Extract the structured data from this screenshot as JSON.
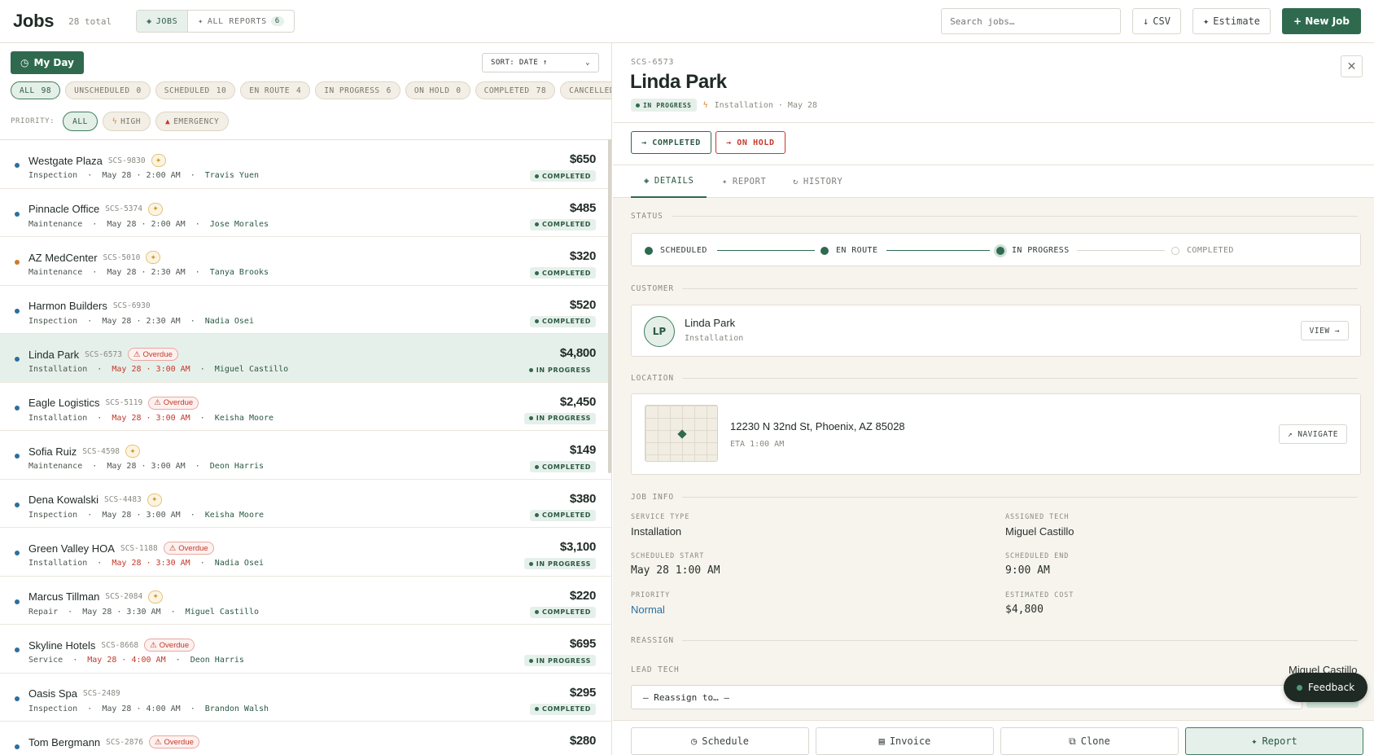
{
  "header": {
    "title": "Jobs",
    "total": "28 total",
    "seg_jobs": "JOBS",
    "seg_reports": "ALL REPORTS",
    "reports_count": "6",
    "search_placeholder": "Search jobs…",
    "csv_label": "CSV",
    "estimate_label": "Estimate",
    "new_job_label": "+ New Job"
  },
  "filters": {
    "my_day": "My Day",
    "sort_label": "SORT: DATE ↑",
    "status_chips": [
      {
        "label": "ALL",
        "count": "98"
      },
      {
        "label": "UNSCHEDULED",
        "count": "0"
      },
      {
        "label": "SCHEDULED",
        "count": "10"
      },
      {
        "label": "EN ROUTE",
        "count": "4"
      },
      {
        "label": "IN PROGRESS",
        "count": "6"
      },
      {
        "label": "ON HOLD",
        "count": "0"
      },
      {
        "label": "COMPLETED",
        "count": "78"
      },
      {
        "label": "CANCELLED",
        "count": ""
      }
    ],
    "priority_label": "PRIORITY:",
    "priority_all": "ALL",
    "priority_high": "HIGH",
    "priority_emergency": "EMERGENCY"
  },
  "jobs": [
    {
      "name": "Westgate Plaza",
      "id": "SCS-9830",
      "type": "Inspection",
      "date": "May 28 · 2:00 AM",
      "tech": "Travis Yuen",
      "amount": "$650",
      "status": "COMPLETED"
    },
    {
      "name": "Pinnacle Office",
      "id": "SCS-5374",
      "type": "Maintenance",
      "date": "May 28 · 2:00 AM",
      "tech": "Jose Morales",
      "amount": "$485",
      "status": "COMPLETED"
    },
    {
      "name": "AZ MedCenter",
      "id": "SCS-5010",
      "type": "Maintenance",
      "date": "May 28 · 2:30 AM",
      "tech": "Tanya Brooks",
      "amount": "$320",
      "status": "COMPLETED"
    },
    {
      "name": "Harmon Builders",
      "id": "SCS-6930",
      "type": "Inspection",
      "date": "May 28 · 2:30 AM",
      "tech": "Nadia Osei",
      "amount": "$520",
      "status": "COMPLETED"
    },
    {
      "name": "Linda Park",
      "id": "SCS-6573",
      "type": "Installation",
      "date": "May 28 · 3:00 AM",
      "tech": "Miguel Castillo",
      "amount": "$4,800",
      "status": "IN PROGRESS",
      "overdue": "Overdue"
    },
    {
      "name": "Eagle Logistics",
      "id": "SCS-5119",
      "type": "Installation",
      "date": "May 28 · 3:00 AM",
      "tech": "Keisha Moore",
      "amount": "$2,450",
      "status": "IN PROGRESS",
      "overdue": "Overdue"
    },
    {
      "name": "Sofia Ruiz",
      "id": "SCS-4598",
      "type": "Maintenance",
      "date": "May 28 · 3:00 AM",
      "tech": "Deon Harris",
      "amount": "$149",
      "status": "COMPLETED"
    },
    {
      "name": "Dena Kowalski",
      "id": "SCS-4483",
      "type": "Inspection",
      "date": "May 28 · 3:00 AM",
      "tech": "Keisha Moore",
      "amount": "$380",
      "status": "COMPLETED"
    },
    {
      "name": "Green Valley HOA",
      "id": "SCS-1188",
      "type": "Installation",
      "date": "May 28 · 3:30 AM",
      "tech": "Nadia Osei",
      "amount": "$3,100",
      "status": "IN PROGRESS",
      "overdue": "Overdue"
    },
    {
      "name": "Marcus Tillman",
      "id": "SCS-2084",
      "type": "Repair",
      "date": "May 28 · 3:30 AM",
      "tech": "Miguel Castillo",
      "amount": "$220",
      "status": "COMPLETED"
    },
    {
      "name": "Skyline Hotels",
      "id": "SCS-8668",
      "type": "Service",
      "date": "May 28 · 4:00 AM",
      "tech": "Deon Harris",
      "amount": "$695",
      "status": "IN PROGRESS",
      "overdue": "Overdue"
    },
    {
      "name": "Oasis Spa",
      "id": "SCS-2489",
      "type": "Inspection",
      "date": "May 28 · 4:00 AM",
      "tech": "Brandon Walsh",
      "amount": "$295",
      "status": "COMPLETED"
    },
    {
      "name": "Tom Bergmann",
      "id": "SCS-2876",
      "type": "",
      "date": "",
      "tech": "",
      "amount": "$280",
      "status": "",
      "overdue": "Overdue"
    }
  ],
  "detail": {
    "id": "SCS-6573",
    "name": "Linda Park",
    "status": "IN PROGRESS",
    "subtitle": "Installation · May 28",
    "btn_completed": "→ COMPLETED",
    "btn_on_hold": "→ ON HOLD",
    "tab_details": "DETAILS",
    "tab_report": "REPORT",
    "tab_history": "HISTORY",
    "sec_status": "STATUS",
    "steps": [
      "SCHEDULED",
      "EN ROUTE",
      "IN PROGRESS",
      "COMPLETED"
    ],
    "sec_customer": "CUSTOMER",
    "customer_initials": "LP",
    "customer_name": "Linda Park",
    "customer_type": "Installation",
    "view_btn": "VIEW →",
    "sec_location": "LOCATION",
    "address": "12230 N 32nd St, Phoenix, AZ 85028",
    "eta": "ETA 1:00 AM",
    "navigate_btn": "↗ NAVIGATE",
    "sec_job_info": "JOB INFO",
    "service_type_label": "SERVICE TYPE",
    "service_type": "Installation",
    "assigned_tech_label": "ASSIGNED TECH",
    "assigned_tech": "Miguel Castillo",
    "sched_start_label": "SCHEDULED START",
    "sched_start": "May 28 1:00 AM",
    "sched_end_label": "SCHEDULED END",
    "sched_end": "9:00 AM",
    "priority_label": "PRIORITY",
    "priority": "Normal",
    "est_cost_label": "ESTIMATED COST",
    "est_cost": "$4,800",
    "sec_reassign": "REASSIGN",
    "lead_tech_label": "LEAD TECH",
    "lead_tech": "Miguel Castillo",
    "reassign_placeholder": "— Reassign to… —",
    "btn_schedule": "Schedule",
    "btn_invoice": "Invoice",
    "btn_clone": "Clone",
    "btn_report": "Report"
  },
  "feedback": "Feedback"
}
